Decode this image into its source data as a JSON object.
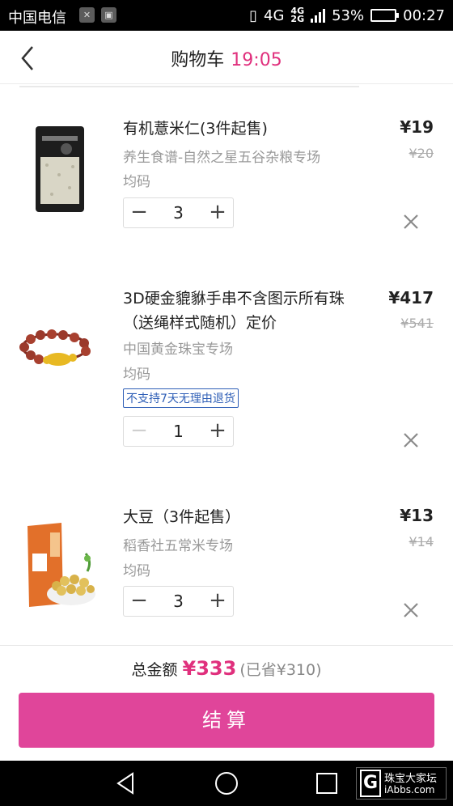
{
  "status_bar": {
    "carrier": "中国电信",
    "network_top": "4G",
    "network_bottom": "2G",
    "network_main": "4G",
    "battery_percent": "53%",
    "battery_level": 0.53,
    "time": "00:27"
  },
  "header": {
    "title": "购物车",
    "timer": "19:05",
    "back_icon": "chevron-left-icon"
  },
  "items": [
    {
      "name": "有机薏米仁(3件起售)",
      "shop": "养生食谱-自然之星五谷杂粮专场",
      "spec": "均码",
      "price": "¥19",
      "original_price": "¥20",
      "quantity": "3",
      "decrease": "−",
      "increase": "+"
    },
    {
      "name": "3D硬金貔貅手串不含图示所有珠（送绳样式随机）定价",
      "shop": "中国黄金珠宝专场",
      "spec": "均码",
      "tag": "不支持7天无理由退货",
      "price": "¥417",
      "original_price": "¥541",
      "quantity": "1",
      "decrease": "−",
      "increase": "+"
    },
    {
      "name": "大豆（3件起售）",
      "shop": "稻香社五常米专场",
      "spec": "均码",
      "price": "¥13",
      "original_price": "¥14",
      "quantity": "3",
      "decrease": "−",
      "increase": "+"
    }
  ],
  "summary": {
    "total_label": "总金额",
    "total_value": "¥333",
    "saved": "(已省¥310)"
  },
  "checkout_label": "结算",
  "nav": {
    "back_icon": "triangle-back-icon",
    "home_icon": "circle-home-icon",
    "recents_icon": "square-recents-icon"
  },
  "watermark": {
    "letter": "G",
    "name": "珠宝大家坛",
    "url": "iAbbs.com"
  },
  "colors": {
    "accent": "#e0307d",
    "checkout": "#e0459a",
    "tag": "#2f5fb7"
  }
}
